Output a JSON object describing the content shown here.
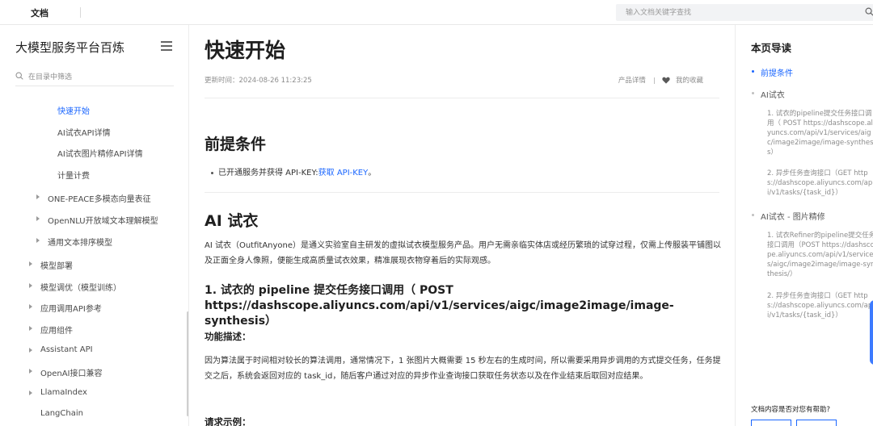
{
  "topbar": {
    "brand": "文档",
    "search_placeholder": "输入文档关键字查找"
  },
  "sidebar": {
    "title": "大模型服务平台百炼",
    "filter_placeholder": "在目录中筛选",
    "items": [
      {
        "label": "快速开始"
      },
      {
        "label": "AI试衣API详情"
      },
      {
        "label": "AI试衣图片精修API详情"
      },
      {
        "label": "计量计费"
      },
      {
        "label": "ONE-PEACE多模态向量表征"
      },
      {
        "label": "OpenNLU开放域文本理解模型"
      },
      {
        "label": "通用文本排序模型"
      },
      {
        "label": "模型部署"
      },
      {
        "label": "模型调优（模型训练）"
      },
      {
        "label": "应用调用API参考"
      },
      {
        "label": "应用组件"
      },
      {
        "label": "Assistant API"
      },
      {
        "label": "OpenAI接口兼容"
      },
      {
        "label": "LlamaIndex"
      },
      {
        "label": "LangChain"
      }
    ]
  },
  "main": {
    "title": "快速开始",
    "updated": "更新时间：2024-08-26 11:23:25",
    "product_detail": "产品详情",
    "favorites": "我的收藏",
    "section1": {
      "heading": "前提条件",
      "bullet_text": "已开通服务并获得 API-KEY:",
      "link_text": "获取 API-KEY",
      "bullet_end": "。"
    },
    "section2": {
      "heading": "AI 试衣",
      "intro": "AI 试衣（OutfitAnyone）是通义实验室自主研发的虚拟试衣模型服务产品。用户无需亲临实体店或经历繁琐的试穿过程，仅需上传服装平铺图以及正面全身人像照，便能生成高质量试衣效果，精准展现衣物穿着后的实际观感。",
      "sub_heading": "1. 试衣的 pipeline 提交任务接口调用（ POST https://dashscope.aliyuncs.com/api/v1/services/aigc/image2image/image-synthesis）",
      "func_heading": "功能描述：",
      "func_text": "因为算法属于时间相对较长的算法调用，通常情况下，1 张图片大概需要 15 秒左右的生成时间，所以需要采用异步调用的方式提交任务，任务提交之后，系统会返回对应的 task_id，随后客户通过对应的异步作业查询接口获取任务状态以及在作业结束后取回对应结果。",
      "request_heading": "请求示例："
    }
  },
  "toc": {
    "title": "本页导读",
    "items": [
      {
        "label": "前提条件"
      },
      {
        "label": "AI试衣"
      },
      {
        "label": "1. 试衣的pipeline提交任务接口调用（ POST https://dashscope.aliyuncs.com/api/v1/services/aigc/image2image/image-synthesis）"
      },
      {
        "label": "2. 异步任务查询接口（GET https://dashscope.aliyuncs.com/api/v1/tasks/{task_id}）"
      },
      {
        "label": "AI试衣 - 图片精修"
      },
      {
        "label": "1. 试衣Refiner的pipeline提交任务接口调用（POST https://dashscope.aliyuncs.com/api/v1/services/aigc/image2image/image-synthesis/）"
      },
      {
        "label": "2. 异步任务查询接口（GET https://dashscope.aliyuncs.com/api/v1/tasks/{task_id}）"
      }
    ],
    "help_question": "文档内容是否对您有帮助?"
  },
  "colors": {
    "accent": "#1a66ff",
    "text": "#1f1f1f",
    "muted": "#8c8c8c"
  }
}
